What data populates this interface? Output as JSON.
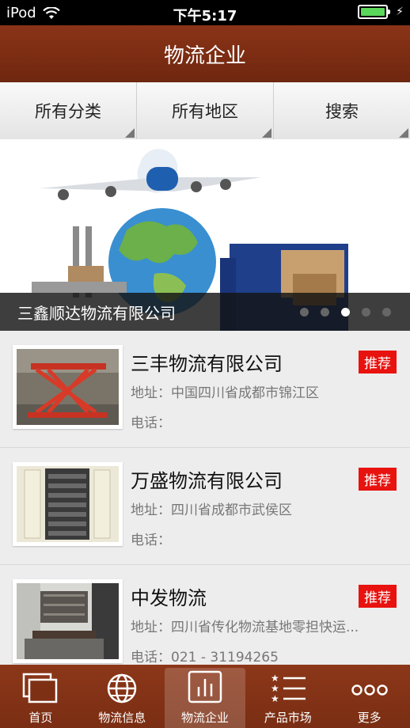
{
  "status": {
    "carrier": "iPod",
    "time": "下午5:17",
    "battery_level": 1.0
  },
  "header": {
    "title": "物流企业"
  },
  "filters": [
    "所有分类",
    "所有地区",
    "搜索"
  ],
  "banner": {
    "caption": "三鑫顺达物流有限公司",
    "slide_count": 5,
    "active_slide": 3
  },
  "companies": [
    {
      "name": "三丰物流有限公司",
      "badge": "推荐",
      "address": "地址：中国四川省成都市锦江区",
      "phone": "电话：",
      "image": "red-scissor-lift"
    },
    {
      "name": "万盛物流有限公司",
      "badge": "推荐",
      "address": "地址：四川省成都市武侯区",
      "phone": "电话：",
      "image": "storage-cabinet"
    },
    {
      "name": "中发物流",
      "badge": "推荐",
      "address": "地址：四川省传化物流基地零担快运...",
      "phone": "电话：021 - 31194265",
      "image": "office-room"
    }
  ],
  "tabbar": {
    "items": [
      {
        "label": "首页",
        "icon": "home-cards-icon"
      },
      {
        "label": "物流信息",
        "icon": "globe-icon"
      },
      {
        "label": "物流企业",
        "icon": "bar-chart-icon"
      },
      {
        "label": "产品市场",
        "icon": "star-list-icon"
      },
      {
        "label": "更多",
        "icon": "more-dots-icon"
      }
    ],
    "active_index": 2
  },
  "colors": {
    "brand": "#7a2e13",
    "badge": "#e8120f"
  }
}
